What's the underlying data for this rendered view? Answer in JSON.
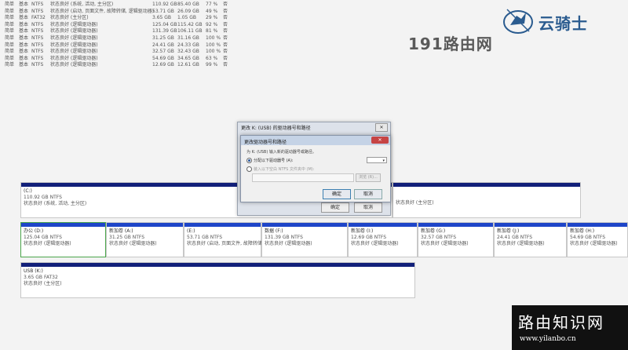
{
  "volumes": [
    {
      "layout": "简单",
      "type": "基本",
      "fs": "NTFS",
      "status": "状态良好 (系统, 活动, 主分区)",
      "capacity": "110.92 GB",
      "free": "85.40 GB",
      "pct": "77 %",
      "fault_tolerance": "否"
    },
    {
      "layout": "简单",
      "type": "基本",
      "fs": "NTFS",
      "status": "状态良好 (启动, 页面文件, 故障转储, 逻辑驱动器)",
      "capacity": "53.71 GB",
      "free": "26.09 GB",
      "pct": "49 %",
      "fault_tolerance": "否"
    },
    {
      "layout": "简单",
      "type": "基本",
      "fs": "FAT32",
      "status": "状态良好 (主分区)",
      "capacity": "3.65 GB",
      "free": "1.05 GB",
      "pct": "29 %",
      "fault_tolerance": "否"
    },
    {
      "layout": "简单",
      "type": "基本",
      "fs": "NTFS",
      "status": "状态良好 (逻辑驱动器)",
      "capacity": "125.04 GB",
      "free": "115.42 GB",
      "pct": "92 %",
      "fault_tolerance": "否"
    },
    {
      "layout": "简单",
      "type": "基本",
      "fs": "NTFS",
      "status": "状态良好 (逻辑驱动器)",
      "capacity": "131.39 GB",
      "free": "106.11 GB",
      "pct": "81 %",
      "fault_tolerance": "否"
    },
    {
      "layout": "简单",
      "type": "基本",
      "fs": "NTFS",
      "status": "状态良好 (逻辑驱动器)",
      "capacity": "31.25 GB",
      "free": "31.16 GB",
      "pct": "100 %",
      "fault_tolerance": "否"
    },
    {
      "layout": "简单",
      "type": "基本",
      "fs": "NTFS",
      "status": "状态良好 (逻辑驱动器)",
      "capacity": "24.41 GB",
      "free": "24.33 GB",
      "pct": "100 %",
      "fault_tolerance": "否"
    },
    {
      "layout": "简单",
      "type": "基本",
      "fs": "NTFS",
      "status": "状态良好 (逻辑驱动器)",
      "capacity": "32.57 GB",
      "free": "32.43 GB",
      "pct": "100 %",
      "fault_tolerance": "否"
    },
    {
      "layout": "简单",
      "type": "基本",
      "fs": "NTFS",
      "status": "状态良好 (逻辑驱动器)",
      "capacity": "54.69 GB",
      "free": "34.65 GB",
      "pct": "63 %",
      "fault_tolerance": "否"
    },
    {
      "layout": "简单",
      "type": "基本",
      "fs": "NTFS",
      "status": "状态良好 (逻辑驱动器)",
      "capacity": "12.69 GB",
      "free": "12.61 GB",
      "pct": "99 %",
      "fault_tolerance": "否"
    }
  ],
  "watermarks": {
    "logo_text": "云骑士",
    "site_191": "191路由网",
    "bottom_title": "路由知识网",
    "bottom_url": "www.yilanbo.cn"
  },
  "disk0": {
    "c": {
      "name": "(C:)",
      "size": "110.92 GB NTFS",
      "status": "状态良好 (系统, 活动, 主分区)"
    },
    "right_status": "状态良好 (主分区)"
  },
  "disk1_parts": [
    {
      "name": "办公 (D:)",
      "size": "125.04 GB NTFS",
      "status": "状态良好 (逻辑驱动器)"
    },
    {
      "name": "新加卷 (A:)",
      "size": "31.25 GB NTFS",
      "status": "状态良好 (逻辑驱动器)"
    },
    {
      "name": "(E:)",
      "size": "53.71 GB NTFS",
      "status": "状态良好 (启动, 页面文件, 故障转储"
    },
    {
      "name": "数据 (F:)",
      "size": "131.39 GB NTFS",
      "status": "状态良好 (逻辑驱动器)"
    },
    {
      "name": "新加卷 (I:)",
      "size": "12.69 GB NTFS",
      "status": "状态良好 (逻辑驱动器)"
    },
    {
      "name": "新加卷 (G:)",
      "size": "32.57 GB NTFS",
      "status": "状态良好 (逻辑驱动器)"
    },
    {
      "name": "新加卷 (J:)",
      "size": "24.41 GB NTFS",
      "status": "状态良好 (逻辑驱动器)"
    },
    {
      "name": "新加卷 (H:)",
      "size": "54.69 GB NTFS",
      "status": "状态良好 (逻辑驱动器)"
    }
  ],
  "usb_part": {
    "name": "USB (K:)",
    "size": "3.65 GB FAT32",
    "status": "状态良好 (主分区)"
  },
  "dialog_back": {
    "title": "更改 K: (USB) 的驱动器号和路径",
    "ok": "确定",
    "cancel": "取消"
  },
  "dialog_front": {
    "title": "更改驱动器号和路径",
    "close": "✕",
    "prompt": "为 K: (USB) 输入新的驱动器号或路径。",
    "opt_letter": "分配以下驱动器号 (A):",
    "opt_folder": "装入以下空白 NTFS 文件夹中 (M):",
    "browse": "浏览 (R)...",
    "ok": "确定",
    "cancel": "取消",
    "drive_value": "▾"
  }
}
